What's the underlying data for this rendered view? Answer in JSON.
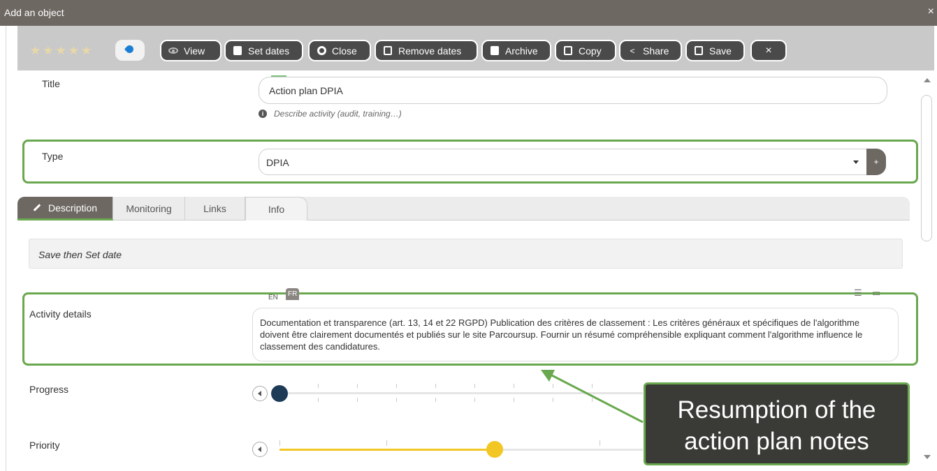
{
  "window": {
    "title": "Add an object",
    "close": "×"
  },
  "toolbar": {
    "stars": "★★★★★",
    "buttons": {
      "view": "View",
      "set_dates": "Set dates",
      "close": "Close",
      "remove_dates": "Remove dates",
      "archive": "Archive",
      "copy": "Copy",
      "share": "Share",
      "save": "Save",
      "dismiss": "×"
    }
  },
  "form": {
    "title_label": "Title",
    "title_value": "Action plan DPIA",
    "title_hint": "Describe activity (audit, training…)",
    "type_label": "Type",
    "type_value": "DPIA",
    "type_add": "+"
  },
  "tabs": [
    {
      "label": "Description"
    },
    {
      "label": "Monitoring"
    },
    {
      "label": "Links"
    },
    {
      "label": "Info"
    }
  ],
  "description": {
    "note": "Save then Set date",
    "activity_label": "Activity details",
    "lang_en": "EN",
    "lang_fr": "FR",
    "activity_text": "Documentation et transparence (art. 13, 14 et 22 RGPD) Publication des critères de classement : Les critères généraux et spécifiques de l'algorithme doivent être clairement documentés et publiés sur le site Parcoursup. Fournir un résumé compréhensible expliquant comment l'algorithme influence le classement des candidatures.",
    "progress_label": "Progress",
    "priority_label": "Priority",
    "progress_level": 0,
    "priority_level": 0.5,
    "progress_color": "#1d3a57",
    "priority_color": "#f2c623"
  },
  "callout": {
    "text": "Resumption of the action plan notes"
  },
  "colors": {
    "highlight": "#6aa84f",
    "titlebar": "#6e6863",
    "button": "#4a4a4a"
  }
}
